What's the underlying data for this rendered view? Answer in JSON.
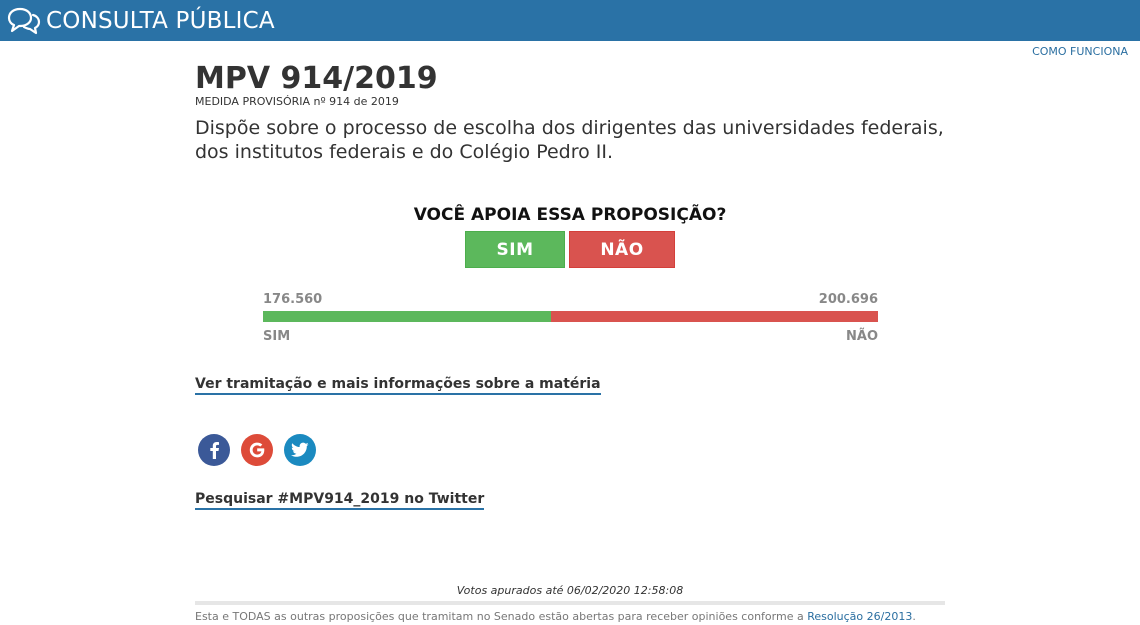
{
  "header": {
    "logo_text": "CONSULTA PÚBLICA",
    "logo_icon": "speech-bubbles-icon",
    "how_it_works": "COMO FUNCIONA"
  },
  "proposition": {
    "title": "MPV 914/2019",
    "subtitle": "MEDIDA PROVISÓRIA nº 914 de 2019",
    "summary_line1": "Dispõe sobre o processo de escolha dos dirigentes das universidades federais,",
    "summary_line2": "dos institutos federais e do Colégio Pedro II."
  },
  "vote": {
    "question": "VOCÊ APOIA ESSA PROPOSIÇÃO?",
    "yes_label": "SIM",
    "no_label": "NÃO"
  },
  "results": {
    "yes_count": "176.560",
    "no_count": "200.696",
    "yes_label": "SIM",
    "no_label": "NÃO",
    "yes_votes": 176560,
    "no_votes": 200696
  },
  "links": {
    "more_info": "Ver tramitação e mais informações sobre a matéria",
    "twitter_search": "Pesquisar #MPV914_2019 no Twitter"
  },
  "social": {
    "icons": [
      "facebook-icon",
      "google-icon",
      "twitter-icon"
    ]
  },
  "footer": {
    "counted_at": "Votos apurados até 06/02/2020 12:58:08",
    "text_prefix": "Esta e TODAS as outras proposições que tramitam no Senado estão abertas para receber opiniões conforme a ",
    "resolution_link": "Resolução 26/2013",
    "text_suffix": "."
  },
  "colors": {
    "header_bg": "#2a72a6",
    "yes": "#5cb85c",
    "no": "#d9534f",
    "facebook": "#3b5998",
    "google": "#dd4b39",
    "twitter": "#1b8ac0"
  }
}
